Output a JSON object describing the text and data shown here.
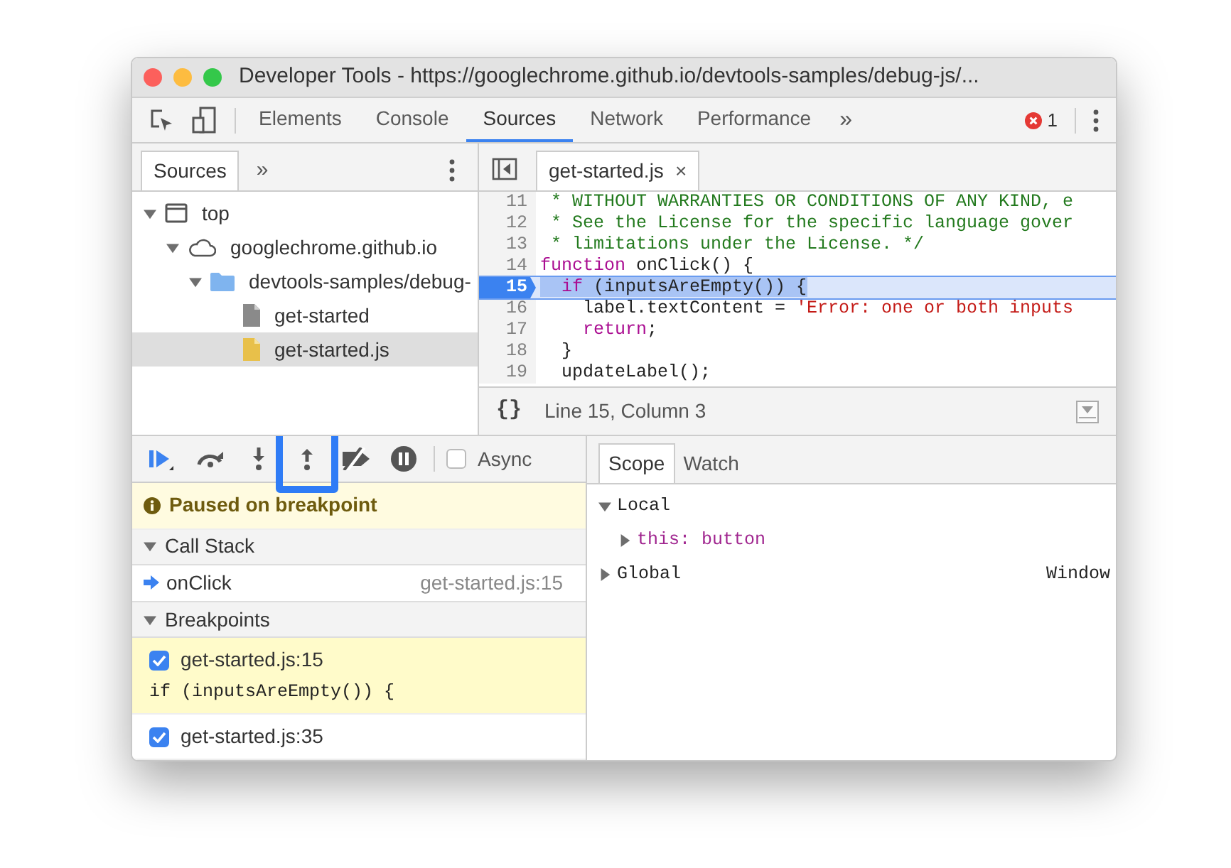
{
  "window": {
    "title": "Developer Tools - https://googlechrome.github.io/devtools-samples/debug-js/..."
  },
  "toolbar": {
    "tabs": [
      {
        "label": "Elements",
        "selected": false
      },
      {
        "label": "Console",
        "selected": false
      },
      {
        "label": "Sources",
        "selected": true
      },
      {
        "label": "Network",
        "selected": false
      },
      {
        "label": "Performance",
        "selected": false
      }
    ],
    "more": "»",
    "error_count": "1"
  },
  "navigator": {
    "tabs": [
      {
        "label": "Sources",
        "selected": true
      }
    ],
    "more": "»",
    "tree": [
      {
        "label": "top",
        "kind": "frame",
        "expanded": true,
        "selected": false,
        "children": [
          {
            "label": "googlechrome.github.io",
            "kind": "domain",
            "expanded": true,
            "selected": false,
            "children": [
              {
                "label": "devtools-samples/debug-",
                "kind": "folder",
                "expanded": true,
                "selected": false,
                "children": [
                  {
                    "label": "get-started",
                    "kind": "page",
                    "selected": false
                  },
                  {
                    "label": "get-started.js",
                    "kind": "script",
                    "selected": true
                  }
                ]
              }
            ]
          }
        ]
      }
    ]
  },
  "editor": {
    "tabs": [
      {
        "label": "get-started.js",
        "selected": true,
        "close": "×"
      }
    ],
    "lines": [
      {
        "number": "11",
        "selected": false,
        "tokens": [
          {
            "kind": "comment",
            "text": " * WITHOUT WARRANTIES OR CONDITIONS OF ANY KIND, e"
          }
        ]
      },
      {
        "number": "12",
        "selected": false,
        "tokens": [
          {
            "kind": "comment",
            "text": " * See the License for the specific language gover"
          }
        ]
      },
      {
        "number": "13",
        "selected": false,
        "tokens": [
          {
            "kind": "comment",
            "text": " * limitations under the License. */"
          }
        ]
      },
      {
        "number": "14",
        "selected": false,
        "tokens": [
          {
            "kind": "keyword",
            "text": "function"
          },
          {
            "kind": "plain",
            "text": " onClick() {"
          }
        ]
      },
      {
        "number": "15",
        "selected": true,
        "tokens": [
          {
            "kind": "keyword",
            "text": "  if"
          },
          {
            "kind": "plain",
            "text": " (inputsAreEmpty()) {"
          }
        ]
      },
      {
        "number": "16",
        "selected": false,
        "tokens": [
          {
            "kind": "plain",
            "text": "    label.textContent = "
          },
          {
            "kind": "string",
            "text": "'Error: one or both inputs"
          }
        ]
      },
      {
        "number": "17",
        "selected": false,
        "tokens": [
          {
            "kind": "keyword",
            "text": "    return"
          },
          {
            "kind": "plain",
            "text": ";"
          }
        ]
      },
      {
        "number": "18",
        "selected": false,
        "tokens": [
          {
            "kind": "plain",
            "text": "  }"
          }
        ]
      },
      {
        "number": "19",
        "selected": false,
        "tokens": [
          {
            "kind": "plain",
            "text": "  updateLabel();"
          }
        ]
      }
    ],
    "status": {
      "format": "{}",
      "position": "Line 15, Column 3"
    }
  },
  "debugger": {
    "controls": [
      {
        "kind": "resume",
        "highlighted": false
      },
      {
        "kind": "step-over",
        "highlighted": false
      },
      {
        "kind": "step-into",
        "highlighted": false
      },
      {
        "kind": "step-out",
        "highlighted": true
      },
      {
        "kind": "deactivate",
        "highlighted": false
      },
      {
        "kind": "pause",
        "highlighted": false
      }
    ],
    "async": {
      "label": "Async",
      "checked": false
    },
    "paused_message": "Paused on breakpoint",
    "call_stack": {
      "title": "Call Stack",
      "expanded": true,
      "frames": [
        {
          "name": "onClick",
          "location": "get-started.js:15",
          "current": true
        }
      ]
    },
    "breakpoints": {
      "title": "Breakpoints",
      "expanded": true,
      "items": [
        {
          "label": "get-started.js:15",
          "code": "if (inputsAreEmpty()) {",
          "checked": true,
          "selected": true
        },
        {
          "label": "get-started.js:35",
          "checked": true,
          "selected": false
        }
      ]
    }
  },
  "sidebar": {
    "tabs": [
      {
        "label": "Scope",
        "selected": true
      },
      {
        "label": "Watch",
        "selected": false
      }
    ],
    "scopes": [
      {
        "name": "Local",
        "expanded": true,
        "children": [
          {
            "name": "this:",
            "value": "button",
            "expanded": false
          }
        ]
      },
      {
        "name": "Global",
        "expanded": false,
        "value": "Window"
      }
    ]
  }
}
